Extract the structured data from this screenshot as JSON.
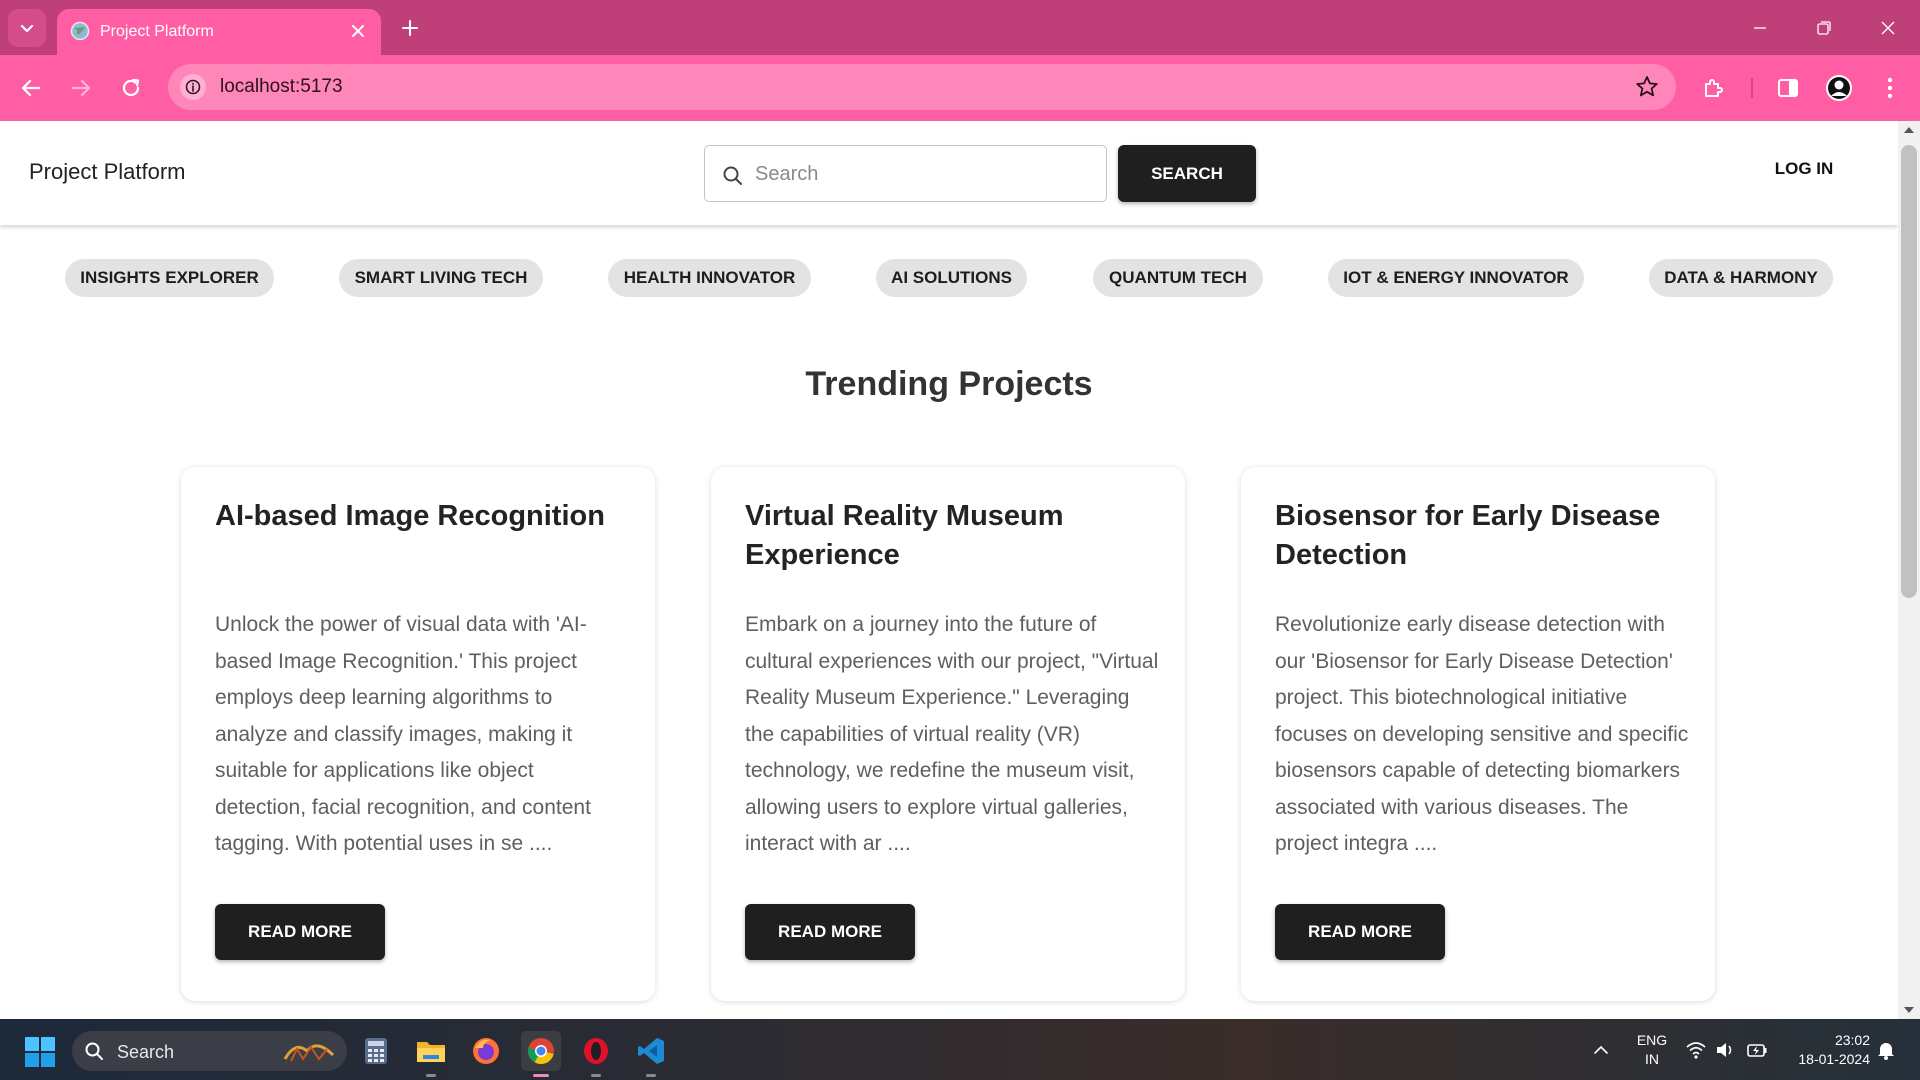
{
  "browser": {
    "tab_title": "Project Platform",
    "url": "localhost:5173"
  },
  "header": {
    "brand": "Project Platform",
    "search_placeholder": "Search",
    "search_button": "SEARCH",
    "login_button": "LOG IN"
  },
  "categories": [
    "INSIGHTS EXPLORER",
    "SMART LIVING TECH",
    "HEALTH INNOVATOR",
    "AI SOLUTIONS",
    "QUANTUM TECH",
    "IOT & ENERGY INNOVATOR",
    "DATA & HARMONY"
  ],
  "main": {
    "section_title": "Trending Projects",
    "projects": [
      {
        "title": "AI-based Image Recognition",
        "description": "Unlock the power of visual data with 'AI-based Image Recognition.' This project employs deep learning algorithms to analyze and classify images, making it suitable for applications like object detection, facial recognition, and content tagging. With potential uses in se ....",
        "button": "READ MORE"
      },
      {
        "title": "Virtual Reality Museum Experience",
        "description": "Embark on a journey into the future of cultural experiences with our project, \"Virtual Reality Museum Experience.\" Leveraging the capabilities of virtual reality (VR) technology, we redefine the museum visit, allowing users to explore virtual galleries, interact with ar ....",
        "button": "READ MORE"
      },
      {
        "title": "Biosensor for Early Disease Detection",
        "description": "Revolutionize early disease detection with our 'Biosensor for Early Disease Detection' project. This biotechnological initiative focuses on developing sensitive and specific biosensors capable of detecting biomarkers associated with various diseases. The project integra ....",
        "button": "READ MORE"
      }
    ]
  },
  "taskbar": {
    "search_label": "Search",
    "language_line1": "ENG",
    "language_line2": "IN",
    "time": "23:02",
    "date": "18-01-2024"
  },
  "colors": {
    "tab_strip": "#bf3f79",
    "toolbar": "#ff5ea4",
    "button_dark": "#1f1f1f",
    "chip_bg": "#e3e3e3"
  }
}
